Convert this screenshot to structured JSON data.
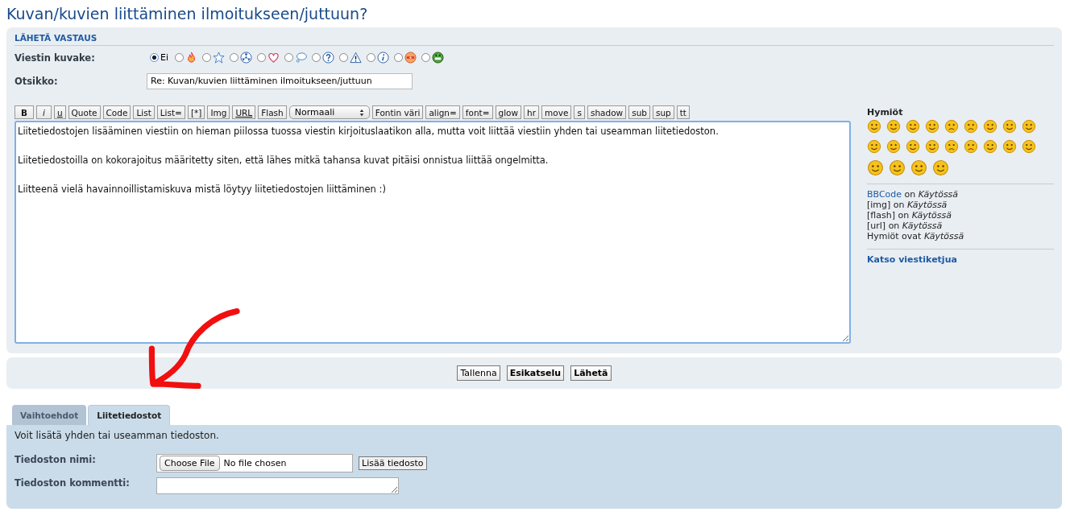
{
  "page_title": "Kuvan/kuvien liittäminen ilmoitukseen/juttuun?",
  "reply_panel": {
    "heading": "LÄHETÄ VASTAUS",
    "icon_label": "Viestin kuvake:",
    "post_icons": [
      {
        "kind": "none",
        "label": "Ei",
        "selected": true
      },
      {
        "kind": "fire",
        "selected": false
      },
      {
        "kind": "star",
        "selected": false
      },
      {
        "kind": "radioactive",
        "selected": false
      },
      {
        "kind": "heart",
        "selected": false
      },
      {
        "kind": "speech",
        "selected": false
      },
      {
        "kind": "question",
        "selected": false
      },
      {
        "kind": "warning",
        "selected": false
      },
      {
        "kind": "info",
        "selected": false
      },
      {
        "kind": "mad",
        "selected": false
      },
      {
        "kind": "grin",
        "selected": false
      }
    ],
    "subject_label": "Otsikko:",
    "subject_value": "Re: Kuvan/kuvien liittäminen ilmoitukseen/juttuun",
    "toolbar": [
      {
        "kind": "bold",
        "label": "B"
      },
      {
        "kind": "italic",
        "label": "i"
      },
      {
        "kind": "underline",
        "label": "u"
      },
      {
        "kind": "plain",
        "label": "Quote"
      },
      {
        "kind": "plain",
        "label": "Code"
      },
      {
        "kind": "plain",
        "label": "List"
      },
      {
        "kind": "plain",
        "label": "List="
      },
      {
        "kind": "plain",
        "label": "[*]"
      },
      {
        "kind": "plain",
        "label": "Img"
      },
      {
        "kind": "underline",
        "label": "URL"
      },
      {
        "kind": "plain",
        "label": "Flash"
      },
      {
        "kind": "select",
        "label": "Normaali"
      },
      {
        "kind": "plain",
        "label": "Fontin väri"
      },
      {
        "kind": "plain",
        "label": "align="
      },
      {
        "kind": "plain",
        "label": "font="
      },
      {
        "kind": "plain",
        "label": "glow"
      },
      {
        "kind": "plain",
        "label": "hr"
      },
      {
        "kind": "plain",
        "label": "move"
      },
      {
        "kind": "plain",
        "label": "s"
      },
      {
        "kind": "plain",
        "label": "shadow"
      },
      {
        "kind": "plain",
        "label": "sub"
      },
      {
        "kind": "plain",
        "label": "sup"
      },
      {
        "kind": "plain",
        "label": "tt"
      }
    ],
    "message": "Liitetiedostojen lisääminen viestiin on hieman piilossa tuossa viestin kirjoituslaatikon alla, mutta voit liittää viestiin yhden tai useamman liitetiedoston.\n\nLiitetiedostoilla on kokorajoitus määritetty siten, että lähes mitkä tahansa kuvat pitäisi onnistua liittää ongelmitta.\n\nLiitteenä vielä havainnoillistamiskuva mistä löytyy liitetiedostojen liittäminen :)",
    "sidebar": {
      "smilies_heading": "Hymiöt",
      "status_lines": [
        {
          "kind": "link",
          "name": "BBCode",
          "text": "on",
          "state": "Käytössä"
        },
        {
          "kind": "plain",
          "name": "[img]",
          "text": "on",
          "state": "Käytössä"
        },
        {
          "kind": "plain",
          "name": "[flash]",
          "text": "on",
          "state": "Käytössä"
        },
        {
          "kind": "plain",
          "name": "[url]",
          "text": "on",
          "state": "Käytössä"
        },
        {
          "kind": "plain",
          "name": "Hymiöt",
          "text": "ovat",
          "state": "Käytössä"
        }
      ],
      "thread_link": "Katso viestiketjua"
    }
  },
  "actions": [
    {
      "label": "Tallenna",
      "primary": false
    },
    {
      "label": "Esikatselu",
      "primary": true
    },
    {
      "label": "Lähetä",
      "primary": true
    }
  ],
  "tabs": [
    {
      "label": "Vaihtoehdot",
      "selected": false
    },
    {
      "label": "Liitetiedostot",
      "selected": true
    }
  ],
  "attachments": {
    "intro": "Voit lisätä yhden tai useamman tiedoston.",
    "file_label": "Tiedoston nimi:",
    "choose_button": "Choose File",
    "no_file": "No file chosen",
    "add_button": "Lisää tiedosto",
    "comment_label": "Tiedoston kommentti:"
  }
}
